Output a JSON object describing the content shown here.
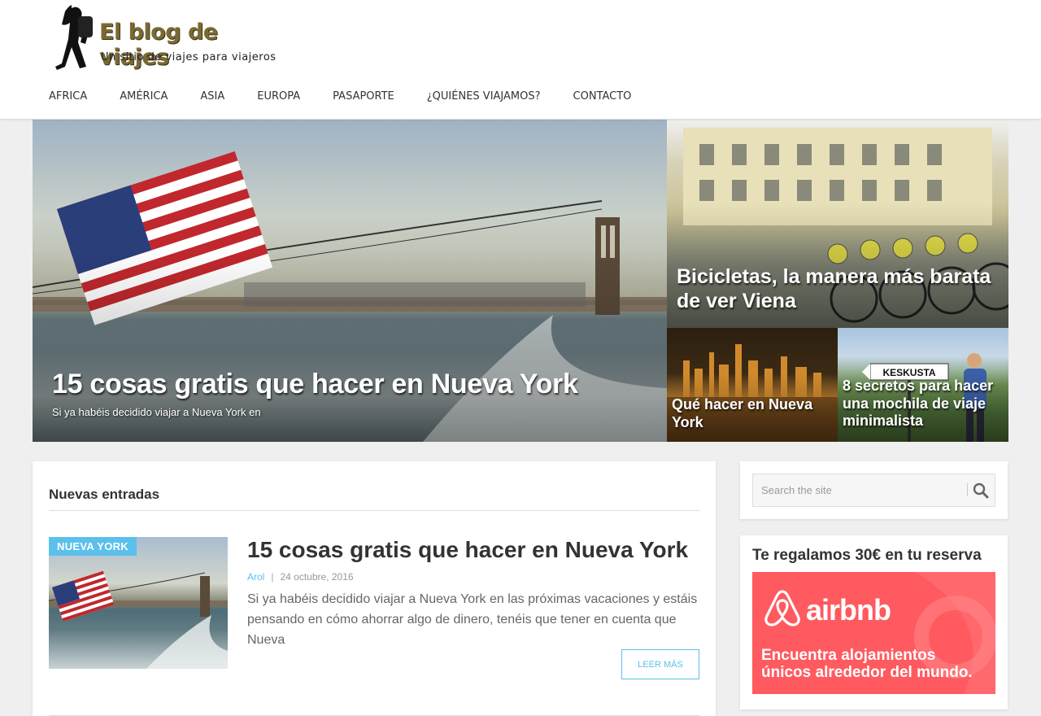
{
  "header": {
    "logo_title": "El blog de viajes",
    "logo_subtitle": "Un sitio de viajes para viajeros"
  },
  "nav": {
    "items": [
      {
        "label": "AFRICA"
      },
      {
        "label": "AMÉRICA"
      },
      {
        "label": "ASIA"
      },
      {
        "label": "EUROPA"
      },
      {
        "label": "PASAPORTE"
      },
      {
        "label": "¿QUIÉNES VIAJAMOS?"
      },
      {
        "label": "CONTACTO"
      }
    ]
  },
  "featured": {
    "main": {
      "title": "15 cosas gratis que hacer en Nueva York",
      "excerpt": "Si ya habéis decidido viajar a Nueva York en"
    },
    "top_right": {
      "title": "Bicicletas, la manera más barata de ver Viena"
    },
    "bottom_left": {
      "title": "Qué hacer en Nueva York"
    },
    "bottom_right": {
      "title": "8 secretos para hacer una mochila de viaje minimalista",
      "sign_text": "KESKUSTA"
    }
  },
  "main": {
    "section_title": "Nuevas entradas",
    "post": {
      "category": "NUEVA YORK",
      "title": "15 cosas gratis que hacer en Nueva York",
      "author": "Arol",
      "separator": "|",
      "date": "24 octubre, 2016",
      "excerpt": "Si ya habéis decidido viajar a Nueva York en las próximas vacaciones y estáis pensando en cómo ahorrar algo de dinero, tenéis que tener en cuenta que Nueva",
      "read_more": "LEER MÁS"
    }
  },
  "sidebar": {
    "search": {
      "placeholder": "Search the site",
      "icon": "search-icon"
    },
    "promo": {
      "title": "Te regalamos 30€ en tu reserva",
      "brand": "airbnb",
      "tagline": "Encuentra alojamientos únicos alrededor del mundo."
    }
  },
  "colors": {
    "accent": "#5bc0eb",
    "airbnb": "#ff5a5f",
    "page_bg": "#efefef"
  }
}
